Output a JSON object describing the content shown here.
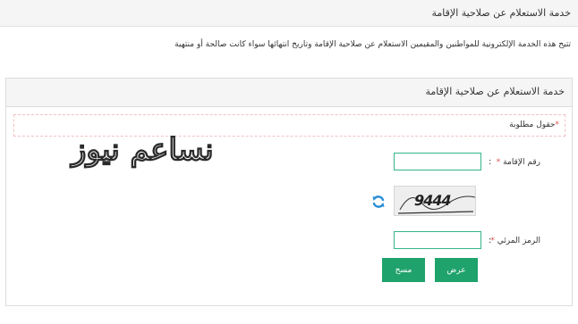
{
  "header": {
    "title": "خدمة الاستعلام عن صلاحية الإقامة"
  },
  "intro": {
    "text": "تتيح هذه الخدمة الإلكترونية للمواطنين والمقيمين الاستعلام عن صلاحية الإقامة وتاريخ انتهائها سواء كانت صالحة أو منتهية"
  },
  "panel": {
    "title": "خدمة الاستعلام عن صلاحية الإقامة",
    "required_star": "*",
    "required_note": "حقول مطلوبة"
  },
  "form": {
    "iqama_label": "رقم الإقامة",
    "iqama_value": "",
    "captcha_label": "الرمز المرئي",
    "captcha_value": "",
    "colon": ":",
    "required_star": "*",
    "captcha_text": "9444"
  },
  "buttons": {
    "view_label": "عرض",
    "clear_label": "مسح"
  },
  "watermark": {
    "text": "نساعم نيوز"
  },
  "colors": {
    "accent": "#1fa26b",
    "input_border": "#34b48d",
    "required": "#d9534f",
    "refresh": "#2a8fd6"
  },
  "icons": {
    "refresh": "refresh-icon"
  }
}
